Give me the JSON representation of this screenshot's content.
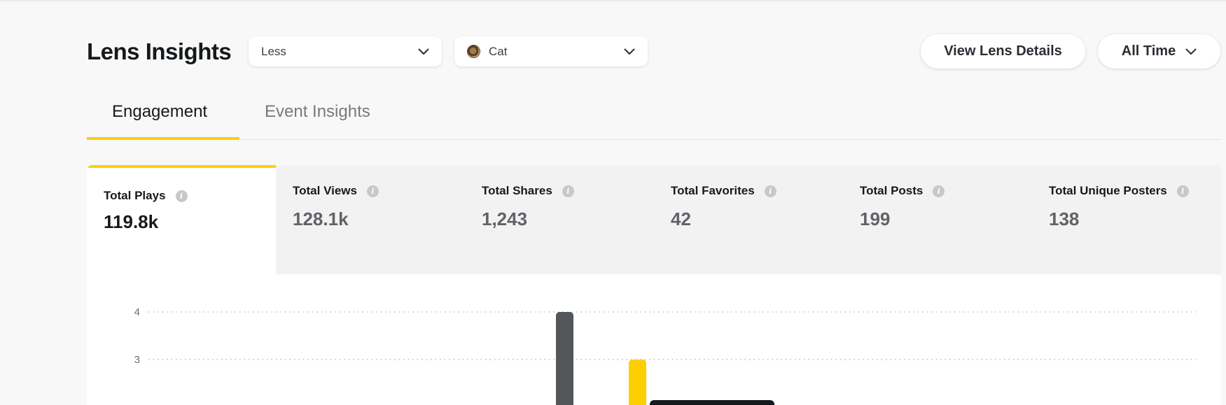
{
  "header": {
    "title": "Lens Insights",
    "dropdown_level": "Less",
    "dropdown_lens": "Cat",
    "view_details_label": "View Lens Details",
    "time_range_label": "All Time"
  },
  "tabs": [
    {
      "label": "Engagement",
      "active": true
    },
    {
      "label": "Event Insights",
      "active": false
    }
  ],
  "metrics": [
    {
      "label": "Total Plays",
      "value": "119.8k",
      "active": true
    },
    {
      "label": "Total Views",
      "value": "128.1k",
      "active": false
    },
    {
      "label": "Total Shares",
      "value": "1,243",
      "active": false
    },
    {
      "label": "Total Favorites",
      "value": "42",
      "active": false
    },
    {
      "label": "Total Posts",
      "value": "199",
      "active": false
    },
    {
      "label": "Total Unique Posters",
      "value": "138",
      "active": false
    }
  ],
  "colors": {
    "accent": "#fcd000",
    "bar_dark": "#53575a",
    "tooltip": "#16191c"
  },
  "chart_data": {
    "type": "bar",
    "y_ticks": [
      "4",
      "3"
    ],
    "grid": true,
    "visible_bars": [
      {
        "series": "dark",
        "value": 4
      },
      {
        "series": "accent",
        "value": 3
      }
    ]
  }
}
